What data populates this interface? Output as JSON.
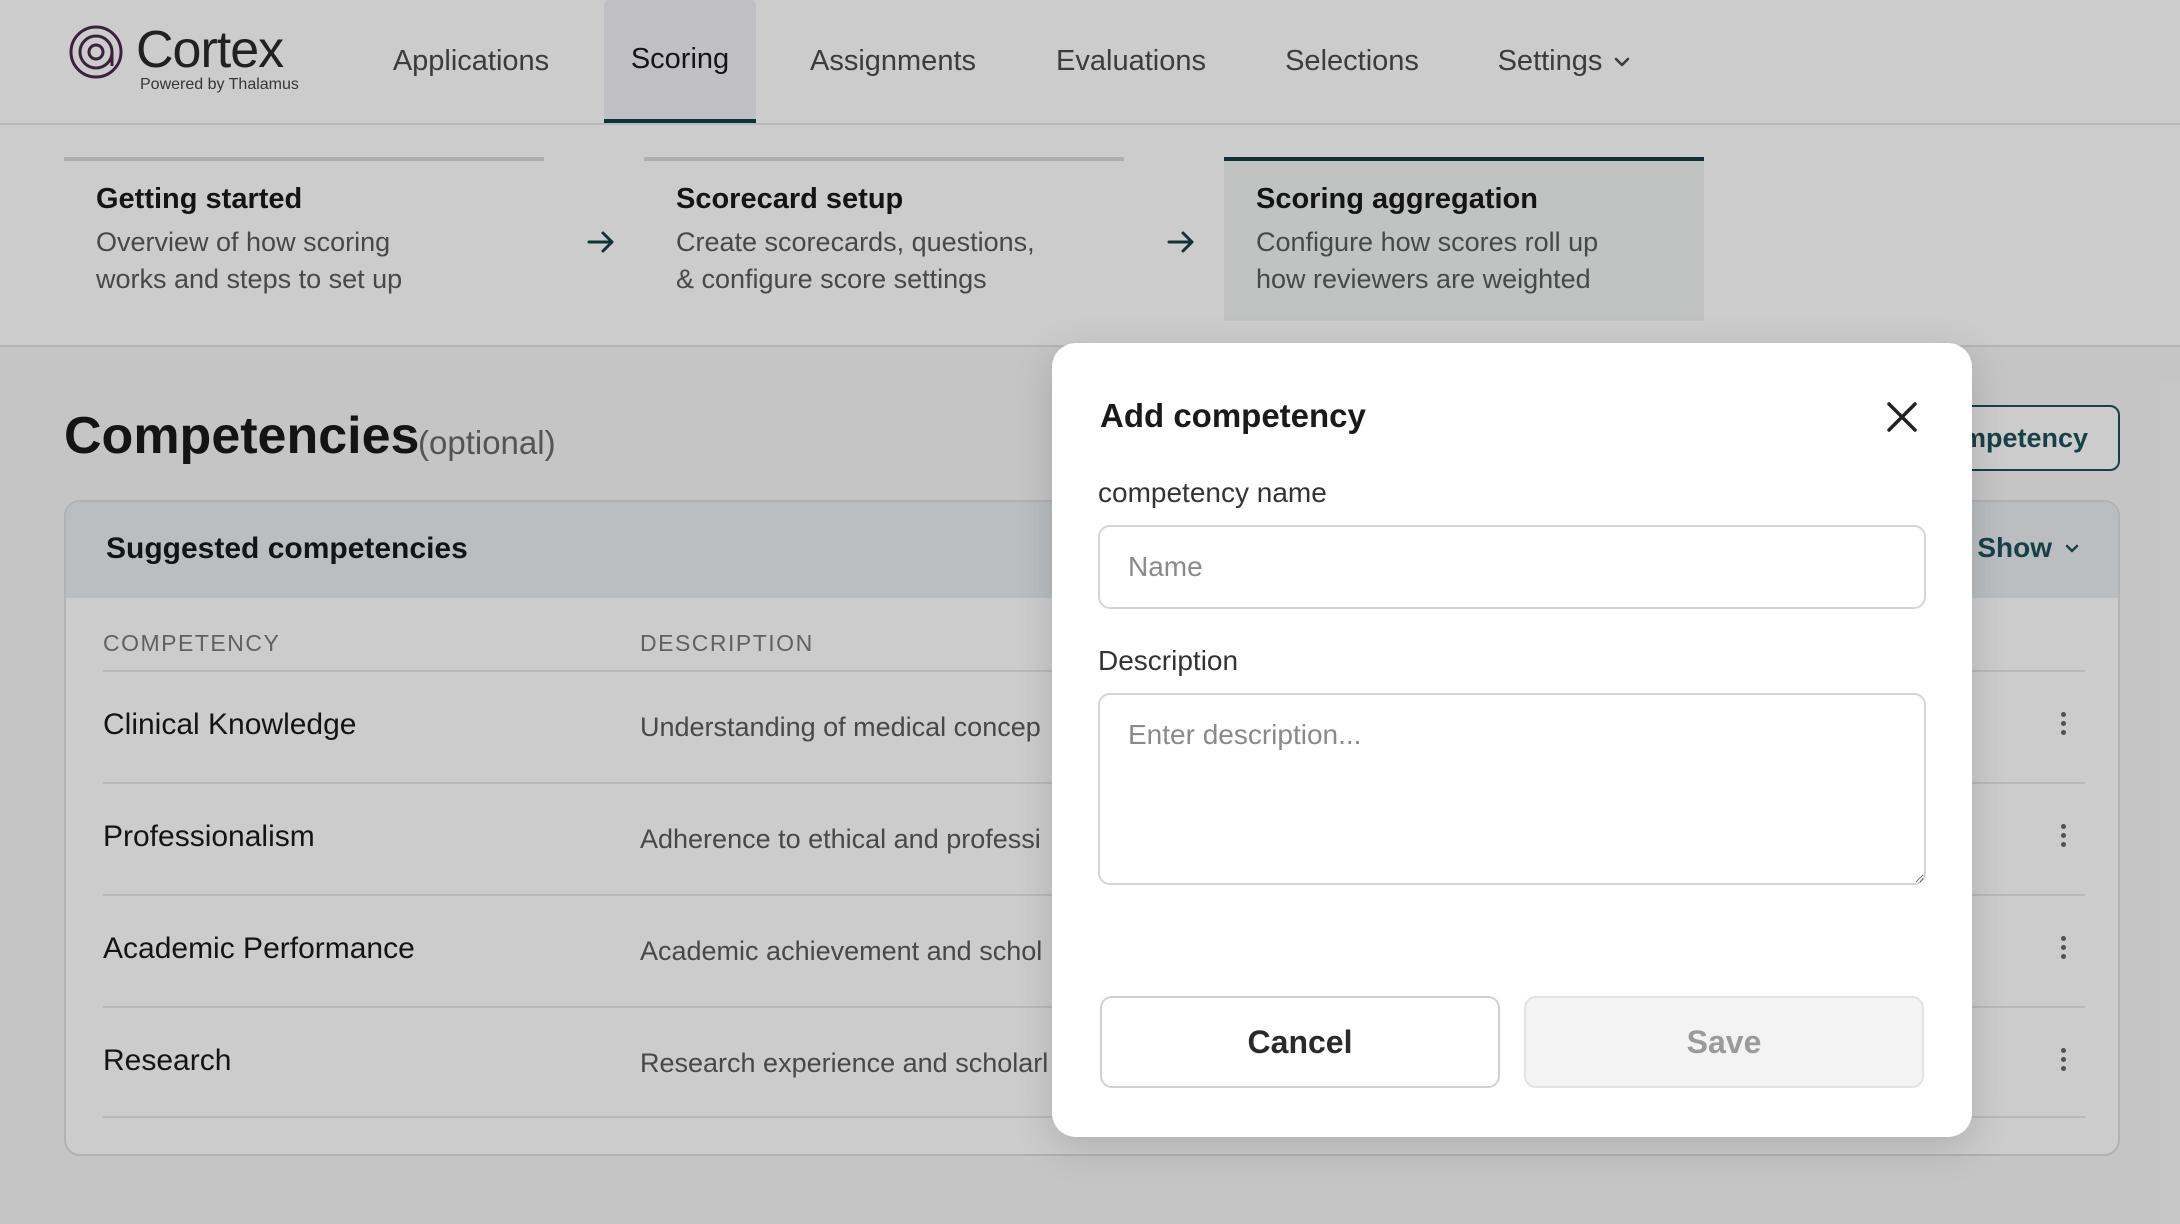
{
  "brand": {
    "name": "Cortex",
    "tagline": "Powered by Thalamus"
  },
  "nav": {
    "tabs": [
      {
        "label": "Applications"
      },
      {
        "label": "Scoring"
      },
      {
        "label": "Assignments"
      },
      {
        "label": "Evaluations"
      },
      {
        "label": "Selections"
      },
      {
        "label": "Settings"
      }
    ],
    "active": "Scoring"
  },
  "steps": [
    {
      "title": "Getting started",
      "desc1": "Overview of how scoring",
      "desc2": "works and steps to set up"
    },
    {
      "title": "Scorecard setup",
      "desc1": "Create scorecards, questions,",
      "desc2": "& configure score settings"
    },
    {
      "title": "Scoring aggregation",
      "desc1": "Configure how scores roll up",
      "desc2": "how reviewers are weighted"
    }
  ],
  "main": {
    "title": "Competencies",
    "title_suffix": "(optional)",
    "add_button": "mpetency",
    "suggested": {
      "title": "Suggested competencies",
      "toggle": "Show",
      "columns": [
        "COMPETENCY",
        "DESCRIPTION"
      ],
      "rows": [
        {
          "name": "Clinical Knowledge",
          "desc": "Understanding of medical concep"
        },
        {
          "name": "Professionalism",
          "desc": "Adherence to ethical and professi"
        },
        {
          "name": "Academic Performance",
          "desc": "Academic achievement and schol"
        },
        {
          "name": "Research",
          "desc": "Research experience and scholarl"
        }
      ]
    }
  },
  "modal": {
    "title": "Add competency",
    "name_label": "competency name",
    "name_placeholder": "Name",
    "name_value": "",
    "desc_label": "Description",
    "desc_placeholder": "Enter description...",
    "desc_value": "",
    "cancel": "Cancel",
    "save": "Save"
  },
  "colors": {
    "accent": "#173f47",
    "accent_text": "#1f5159",
    "overlay": "rgba(0,0,0,0.2)"
  }
}
